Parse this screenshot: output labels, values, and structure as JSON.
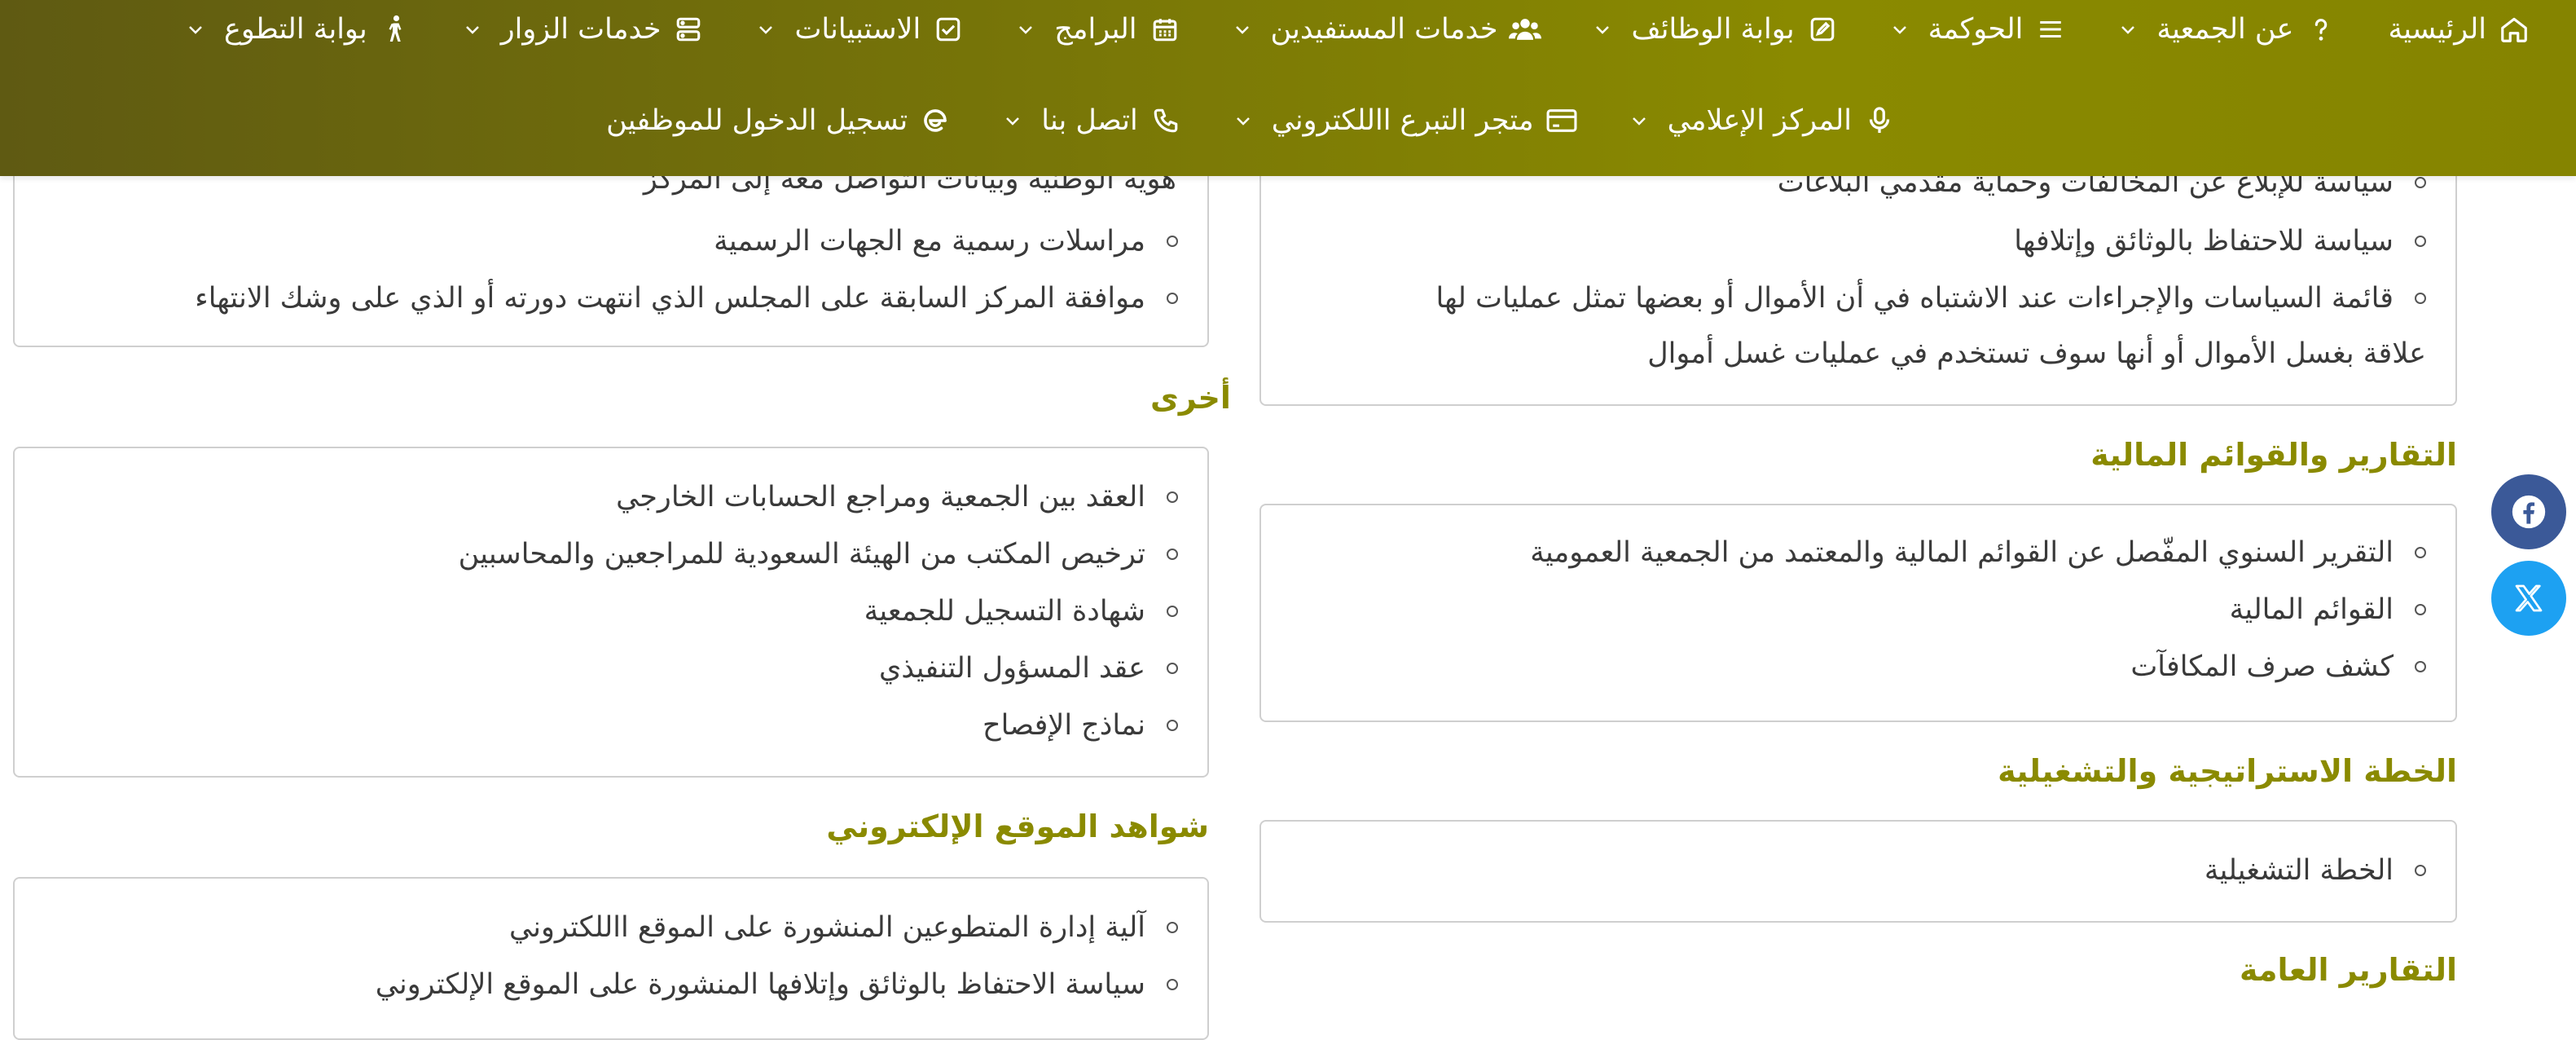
{
  "nav": {
    "row1": [
      {
        "label": "الرئيسية",
        "icon": "home-icon",
        "chevron": false
      },
      {
        "label": "عن الجمعية",
        "icon": "question-icon",
        "chevron": true
      },
      {
        "label": "الحوكمة",
        "icon": "list-icon",
        "chevron": true
      },
      {
        "label": "بوابة الوظائف",
        "icon": "edit-square-icon",
        "chevron": true
      },
      {
        "label": "خدمات المستفيدين",
        "icon": "users-icon",
        "chevron": true
      },
      {
        "label": "البرامج",
        "icon": "calendar-icon",
        "chevron": true
      },
      {
        "label": "الاستبيانات",
        "icon": "checkbox-icon",
        "chevron": true
      },
      {
        "label": "خدمات الزوار",
        "icon": "server-icon",
        "chevron": true
      },
      {
        "label": "بوابة التطوع",
        "icon": "walking-person-icon",
        "chevron": true
      }
    ],
    "row2": [
      {
        "label": "المركز الإعلامي",
        "icon": "microphone-icon",
        "chevron": true
      },
      {
        "label": "متجر التبرع االلكتروني",
        "icon": "credit-card-icon",
        "chevron": true
      },
      {
        "label": "اتصل بنا",
        "icon": "phone-icon",
        "chevron": true
      },
      {
        "label": "تسجيل الدخول للموظفين",
        "icon": "edge-browser-icon",
        "chevron": false
      }
    ]
  },
  "right_column": {
    "top_box": {
      "items": [
        "سياسة للإبلاغ عن المخالفات وحماية مقدمي البلاغات",
        "سياسة للاحتفاظ بالوثائق وإتلافها",
        "قائمة السياسات والإجراءات عند الاشتباه في أن الأموال أو بعضها تمثل عمليات لها"
      ],
      "continuation": "علاقة بغسل الأموال أو أنها سوف تستخدم في عمليات غسل أموال"
    },
    "financial": {
      "heading": "التقارير والقوائم المالية",
      "items": [
        "التقرير السنوي المفّصل عن القوائم المالية والمعتمد من الجمعية العمومية",
        "القوائم المالية",
        "كشف صرف المكافآت"
      ]
    },
    "strategic": {
      "heading": "الخطة الاستراتيجية والتشغيلية",
      "items": [
        "الخطة التشغيلية"
      ]
    },
    "general_reports": {
      "heading": "التقارير العامة"
    }
  },
  "left_column": {
    "top_box": {
      "partial_line": "هوية الوطنية وبيانات التواصل معه إلى المركز",
      "items": [
        "مراسلات رسمية مع الجهات الرسمية",
        "موافقة المركز السابقة على المجلس الذي انتهت دورته أو الذي على وشك الانتهاء"
      ]
    },
    "other": {
      "heading": "أخرى",
      "items": [
        "العقد بين الجمعية ومراجع الحسابات الخارجي",
        "ترخيص المكتب من الهيئة السعودية للمراجعين والمحاسبين",
        "شهادة التسجيل للجمعية",
        "عقد المسؤول التنفيذي",
        "نماذج الإفصاح"
      ]
    },
    "website": {
      "heading": "شواهد الموقع الإلكتروني",
      "items": [
        "آلية إدارة المتطوعين المنشورة على الموقع االلكتروني",
        "سياسة الاحتفاظ بالوثائق وإتلافها المنشورة على الموقع الإلكتروني"
      ]
    }
  },
  "social": {
    "facebook": "facebook-icon",
    "twitter": "x-twitter-icon"
  },
  "colors": {
    "nav_start": "#5f5a12",
    "nav_end": "#858400",
    "heading": "#8a8a00",
    "facebook": "#3b5998",
    "twitter": "#1da1f2"
  }
}
